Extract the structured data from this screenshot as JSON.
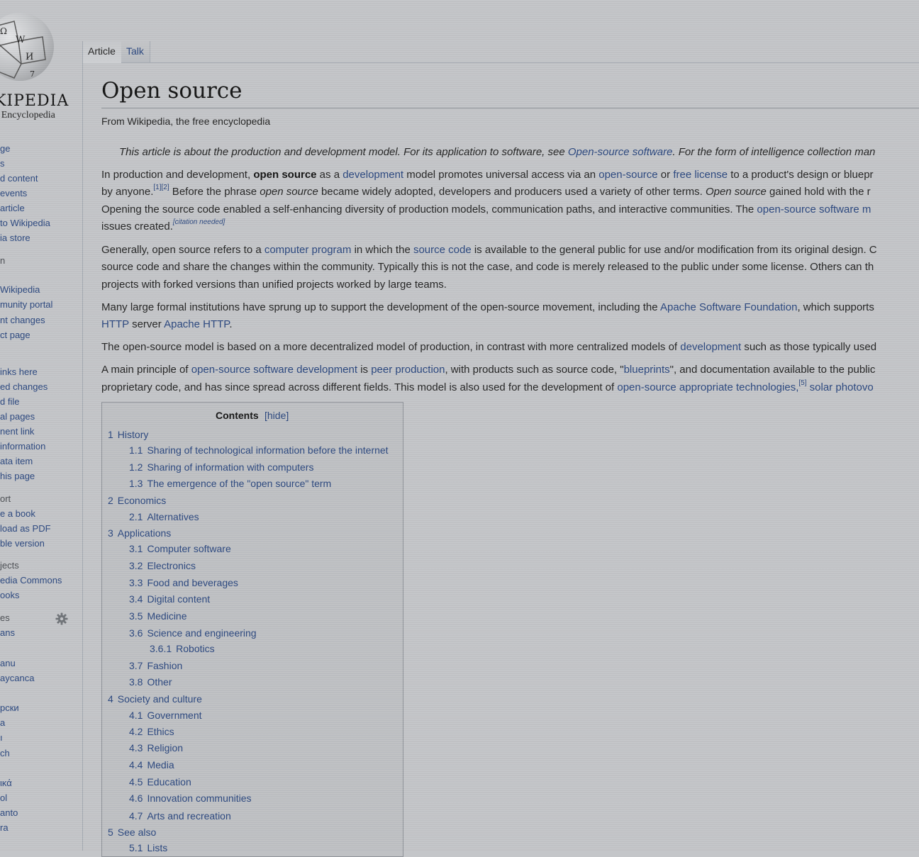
{
  "sidebar": {
    "logo_wordmark": "KIPEDIA",
    "logo_tagline": "e Encyclopedia",
    "items": [
      {
        "label": "ge",
        "type": "link"
      },
      {
        "label": "s",
        "type": "link"
      },
      {
        "label": "d content",
        "type": "link"
      },
      {
        "label": "events",
        "type": "link"
      },
      {
        "label": "article",
        "type": "link"
      },
      {
        "label": "to Wikipedia",
        "type": "link"
      },
      {
        "label": "ia store",
        "type": "link"
      },
      {
        "label": "n",
        "type": "head"
      },
      {
        "label": "Wikipedia",
        "type": "link"
      },
      {
        "label": "munity portal",
        "type": "link"
      },
      {
        "label": "nt changes",
        "type": "link"
      },
      {
        "label": "ct page",
        "type": "link"
      },
      {
        "label": "inks here",
        "type": "link"
      },
      {
        "label": "ed changes",
        "type": "link"
      },
      {
        "label": "d file",
        "type": "link"
      },
      {
        "label": "al pages",
        "type": "link"
      },
      {
        "label": "nent link",
        "type": "link"
      },
      {
        "label": "information",
        "type": "link"
      },
      {
        "label": "ata item",
        "type": "link"
      },
      {
        "label": "his page",
        "type": "link"
      },
      {
        "label": "ort",
        "type": "head"
      },
      {
        "label": "e a book",
        "type": "link"
      },
      {
        "label": "load as PDF",
        "type": "link"
      },
      {
        "label": "ble version",
        "type": "link"
      },
      {
        "label": "jects",
        "type": "head"
      },
      {
        "label": "edia Commons",
        "type": "link"
      },
      {
        "label": "ooks",
        "type": "link"
      },
      {
        "label": "es",
        "type": "head"
      },
      {
        "label": "ans",
        "type": "link"
      },
      {
        "label": "anu",
        "type": "link"
      },
      {
        "label": "aycanca",
        "type": "link"
      },
      {
        "label": "рски",
        "type": "link"
      },
      {
        "label": "а",
        "type": "link"
      },
      {
        "label": "ı",
        "type": "link"
      },
      {
        "label": "ch",
        "type": "link"
      },
      {
        "label": "ικά",
        "type": "link"
      },
      {
        "label": "ol",
        "type": "link"
      },
      {
        "label": "anto",
        "type": "link"
      },
      {
        "label": "ra",
        "type": "link"
      }
    ],
    "gear_icon": "gear-icon"
  },
  "tabs": {
    "article": "Article",
    "talk": "Talk"
  },
  "article": {
    "title": "Open source",
    "from": "From Wikipedia, the free encyclopedia",
    "hatnote": {
      "t1": "This article is about the production and development model. For its application to software, see ",
      "l1": "Open-source software",
      "t2": ". For the form of intelligence collection man"
    },
    "p1": {
      "l1": {
        "t1": "In production and development, ",
        "b1": "open source",
        "t2": " as a ",
        "a1": "development",
        "t3": " model promotes universal access via an ",
        "a2": "open-source",
        "t4": " or ",
        "a3": "free license",
        "t5": " to a product's design or bluepr"
      },
      "l2": {
        "t1": "by anyone.",
        "s1": "[1][2]",
        "t2": " Before the phrase ",
        "i1": "open source",
        "t3": " became widely adopted, developers and producers used a variety of other terms. ",
        "i2": "Open source",
        "t4": " gained hold with the r"
      },
      "l3": {
        "t1": "Opening the source code enabled a self-enhancing diversity of production models, communication paths, and interactive communities. The ",
        "a1": "open-source software m"
      },
      "l4": {
        "t1": "issues created.",
        "s1": "[citation needed]"
      }
    },
    "p2": {
      "l1": {
        "t1": "Generally, open source refers to a ",
        "a1": "computer program",
        "t2": " in which the ",
        "a2": "source code",
        "t3": " is available to the general public for use and/or modification from its original design. C"
      },
      "l2": "source code and share the changes within the community. Typically this is not the case, and code is merely released to the public under some license. Others can th",
      "l3": "projects with forked versions than unified projects worked by large teams."
    },
    "p3": {
      "l1": {
        "t1": "Many large formal institutions have sprung up to support the development of the open-source movement, including the ",
        "a1": "Apache Software Foundation",
        "t2": ", which supports"
      },
      "l2": {
        "a1": "HTTP",
        "t1": " server ",
        "a2": "Apache HTTP",
        "t2": "."
      }
    },
    "p4": {
      "t1": "The open-source model is based on a more decentralized model of production, in contrast with more centralized models of ",
      "a1": "development",
      "t2": " such as those typically used"
    },
    "p5": {
      "l1": {
        "t1": "A main principle of ",
        "a1": "open-source software development",
        "t2": " is ",
        "a2": "peer production",
        "t3": ", with products such as source code, \"",
        "a3": "blueprints",
        "t4": "\", and documentation available to the public"
      },
      "l2": {
        "t1": "proprietary code, and has since spread across different fields. This model is also used for the development of ",
        "a1": "open-source appropriate technologies,",
        "s1": "[5]",
        "a2": " solar photovo"
      }
    }
  },
  "toc": {
    "title": "Contents",
    "hide": "[hide]",
    "items": [
      {
        "num": "1",
        "label": "History",
        "level": 1
      },
      {
        "num": "1.1",
        "label": "Sharing of technological information before the internet",
        "level": 2
      },
      {
        "num": "1.2",
        "label": "Sharing of information with computers",
        "level": 2
      },
      {
        "num": "1.3",
        "label": "The emergence of the \"open source\" term",
        "level": 2
      },
      {
        "num": "2",
        "label": "Economics",
        "level": 1
      },
      {
        "num": "2.1",
        "label": "Alternatives",
        "level": 2
      },
      {
        "num": "3",
        "label": "Applications",
        "level": 1
      },
      {
        "num": "3.1",
        "label": "Computer software",
        "level": 2
      },
      {
        "num": "3.2",
        "label": "Electronics",
        "level": 2
      },
      {
        "num": "3.3",
        "label": "Food and beverages",
        "level": 2
      },
      {
        "num": "3.4",
        "label": "Digital content",
        "level": 2
      },
      {
        "num": "3.5",
        "label": "Medicine",
        "level": 2
      },
      {
        "num": "3.6",
        "label": "Science and engineering",
        "level": 2
      },
      {
        "num": "3.6.1",
        "label": "Robotics",
        "level": 3
      },
      {
        "num": "3.7",
        "label": "Fashion",
        "level": 2
      },
      {
        "num": "3.8",
        "label": "Other",
        "level": 2
      },
      {
        "num": "4",
        "label": "Society and culture",
        "level": 1
      },
      {
        "num": "4.1",
        "label": "Government",
        "level": 2
      },
      {
        "num": "4.2",
        "label": "Ethics",
        "level": 2
      },
      {
        "num": "4.3",
        "label": "Religion",
        "level": 2
      },
      {
        "num": "4.4",
        "label": "Media",
        "level": 2
      },
      {
        "num": "4.5",
        "label": "Education",
        "level": 2
      },
      {
        "num": "4.6",
        "label": "Innovation communities",
        "level": 2
      },
      {
        "num": "4.7",
        "label": "Arts and recreation",
        "level": 2
      },
      {
        "num": "5",
        "label": "See also",
        "level": 1
      },
      {
        "num": "5.1",
        "label": "Lists",
        "level": 2
      }
    ]
  },
  "colors": {
    "link": "#28457e",
    "background": "#c4c6c9",
    "text": "#222222"
  }
}
